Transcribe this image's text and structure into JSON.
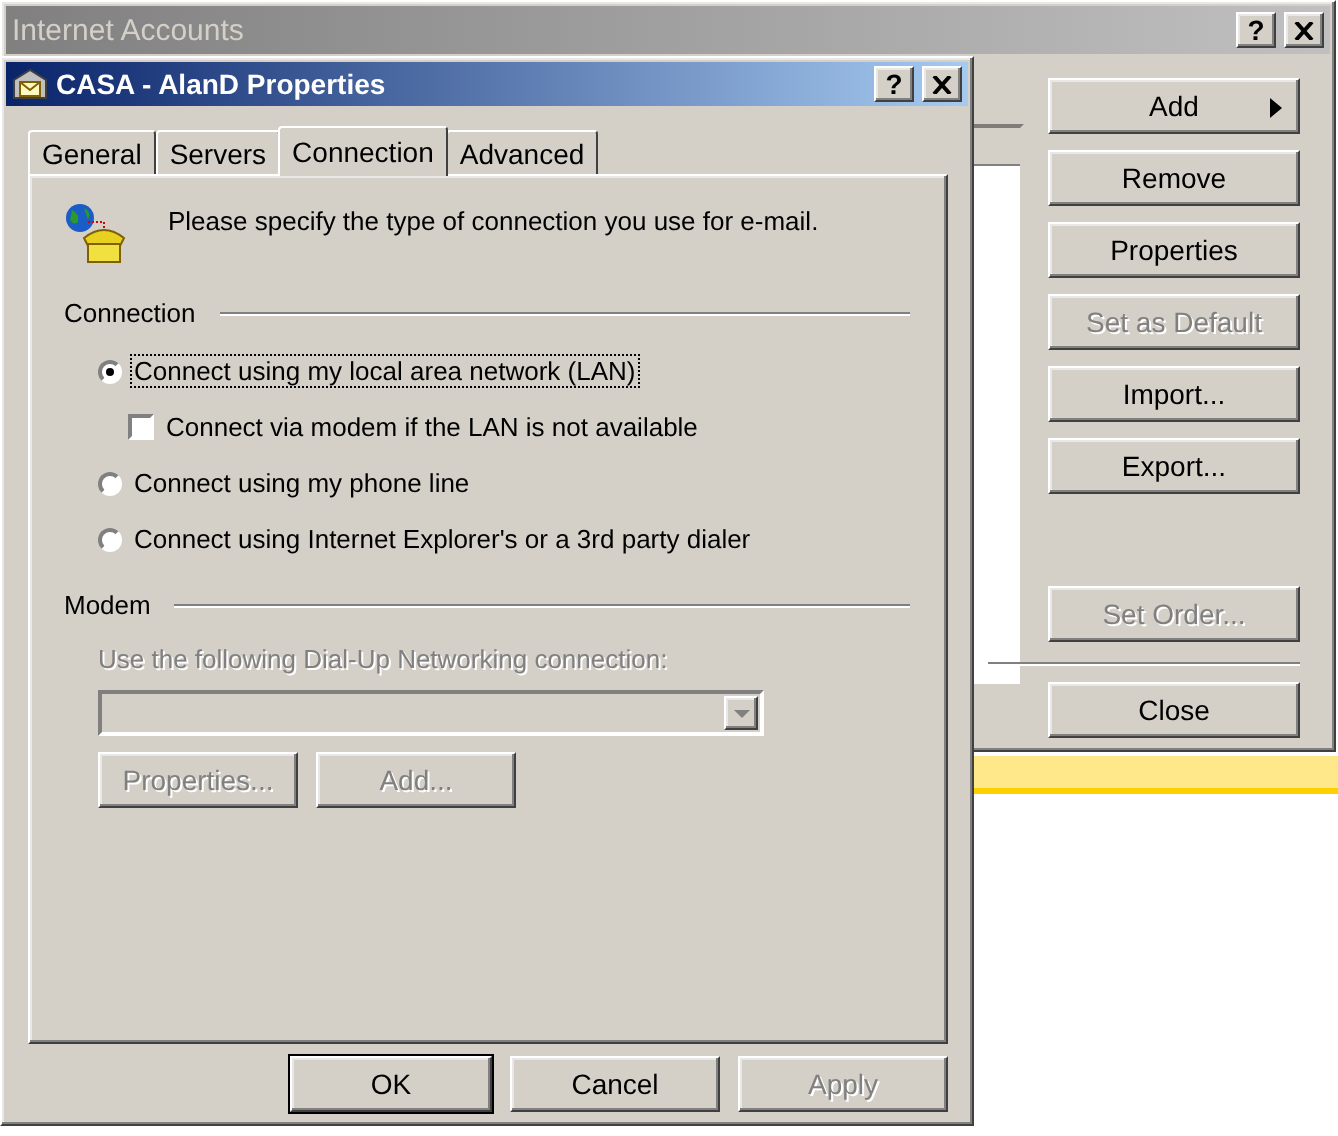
{
  "background_window": {
    "title": "Internet Accounts",
    "help_button": "?",
    "buttons": [
      {
        "label": "Add",
        "disabled": false,
        "submenu": true
      },
      {
        "label": "Remove",
        "disabled": false,
        "submenu": false
      },
      {
        "label": "Properties",
        "disabled": false,
        "submenu": false
      },
      {
        "label": "Set as Default",
        "disabled": true,
        "submenu": false
      },
      {
        "label": "Import...",
        "disabled": false,
        "submenu": false
      },
      {
        "label": "Export...",
        "disabled": false,
        "submenu": false
      }
    ],
    "order_button": {
      "label": "Set Order...",
      "disabled": true
    },
    "close_button": {
      "label": "Close",
      "disabled": false
    }
  },
  "dialog": {
    "title": "CASA - AlanD Properties",
    "help_button": "?",
    "tabs": [
      {
        "label": "General",
        "selected": false
      },
      {
        "label": "Servers",
        "selected": false
      },
      {
        "label": "Connection",
        "selected": true
      },
      {
        "label": "Advanced",
        "selected": false
      }
    ],
    "intro": "Please specify the type of connection you use for e-mail.",
    "connection": {
      "label": "Connection",
      "options": [
        {
          "kind": "radio",
          "label": "Connect using my local area network (LAN)",
          "selected": true,
          "focused": true
        },
        {
          "kind": "checkbox",
          "label": "Connect via modem if the LAN is not available",
          "checked": false,
          "focused": false
        },
        {
          "kind": "radio",
          "label": "Connect using my phone line",
          "selected": false,
          "focused": false
        },
        {
          "kind": "radio",
          "label": "Connect using Internet Explorer's or a 3rd party dialer",
          "selected": false,
          "focused": false
        }
      ]
    },
    "modem": {
      "label": "Modem",
      "prompt": "Use the following Dial-Up Networking connection:",
      "disabled": true,
      "buttons": [
        {
          "label": "Properties...",
          "disabled": true
        },
        {
          "label": "Add...",
          "disabled": true
        }
      ]
    },
    "footer_buttons": [
      {
        "label": "OK",
        "default": true,
        "disabled": false
      },
      {
        "label": "Cancel",
        "default": false,
        "disabled": false
      },
      {
        "label": "Apply",
        "default": false,
        "disabled": true
      }
    ]
  }
}
